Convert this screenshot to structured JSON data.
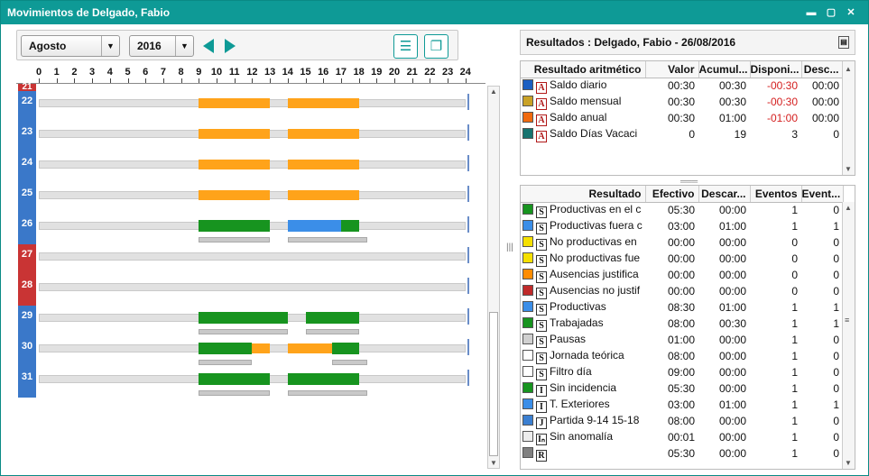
{
  "window": {
    "title": "Movimientos de Delgado, Fabio",
    "controls": [
      "▬",
      "▢",
      "✕"
    ]
  },
  "toolbar": {
    "month": "Agosto",
    "year": "2016"
  },
  "axis": {
    "hours": [
      "0",
      "1",
      "2",
      "3",
      "4",
      "5",
      "6",
      "7",
      "8",
      "9",
      "10",
      "11",
      "12",
      "13",
      "14",
      "15",
      "16",
      "17",
      "18",
      "19",
      "20",
      "21",
      "22",
      "23",
      "24"
    ]
  },
  "days": [
    {
      "label": "21",
      "type": "partial"
    },
    {
      "label": "22",
      "type": "work"
    },
    {
      "label": "23",
      "type": "work"
    },
    {
      "label": "24",
      "type": "work"
    },
    {
      "label": "25",
      "type": "work"
    },
    {
      "label": "26",
      "type": "worked"
    },
    {
      "label": "27",
      "type": "holiday"
    },
    {
      "label": "28",
      "type": "holiday"
    },
    {
      "label": "29",
      "type": "worked"
    },
    {
      "label": "30",
      "type": "worked"
    },
    {
      "label": "31",
      "type": "worked"
    }
  ],
  "results_header": "Resultados : Delgado, Fabio - 26/08/2016",
  "arith": {
    "headers": [
      "Resultado aritmético",
      "Valor",
      "Acumul...",
      "Disponi...",
      "Desc..."
    ],
    "rows": [
      {
        "color": "#1b5fc2",
        "icon": "A",
        "name": "Saldo diario",
        "valor": "00:30",
        "acum": "00:30",
        "disp": "-00:30",
        "desc": "00:00"
      },
      {
        "color": "#c9a227",
        "icon": "A",
        "name": "Saldo mensual",
        "valor": "00:30",
        "acum": "00:30",
        "disp": "-00:30",
        "desc": "00:00"
      },
      {
        "color": "#f06a0f",
        "icon": "A",
        "name": "Saldo anual",
        "valor": "00:30",
        "acum": "01:00",
        "disp": "-01:00",
        "desc": "00:00"
      },
      {
        "color": "#17736f",
        "icon": "A",
        "name": "Saldo Días Vacaci",
        "valor": "0",
        "acum": "19",
        "disp": "3",
        "desc": "0"
      }
    ]
  },
  "results": {
    "headers": [
      "Resultado",
      "Efectivo",
      "Descar...",
      "Eventos",
      "Event..."
    ],
    "rows": [
      {
        "color": "#17941f",
        "icon": "S",
        "name": "Productivas en el c",
        "ef": "05:30",
        "de": "00:00",
        "ev": "1",
        "ev2": "0"
      },
      {
        "color": "#3b8ee8",
        "icon": "S",
        "name": "Productivas fuera c",
        "ef": "03:00",
        "de": "01:00",
        "ev": "1",
        "ev2": "1"
      },
      {
        "color": "#f5e000",
        "icon": "S",
        "name": "No productivas en",
        "ef": "00:00",
        "de": "00:00",
        "ev": "0",
        "ev2": "0"
      },
      {
        "color": "#f5e000",
        "icon": "S",
        "name": "No productivas fue",
        "ef": "00:00",
        "de": "00:00",
        "ev": "0",
        "ev2": "0"
      },
      {
        "color": "#ff8c00",
        "icon": "S",
        "name": "Ausencias justifica",
        "ef": "00:00",
        "de": "00:00",
        "ev": "0",
        "ev2": "0"
      },
      {
        "color": "#c02a2a",
        "icon": "S",
        "name": "Ausencias no justif",
        "ef": "00:00",
        "de": "00:00",
        "ev": "0",
        "ev2": "0"
      },
      {
        "color": "#3b8ee8",
        "icon": "S",
        "name": "Productivas",
        "ef": "08:30",
        "de": "01:00",
        "ev": "1",
        "ev2": "1"
      },
      {
        "color": "#17941f",
        "icon": "S",
        "name": "Trabajadas",
        "ef": "08:00",
        "de": "00:30",
        "ev": "1",
        "ev2": "1"
      },
      {
        "color": "#d0d0d0",
        "icon": "S",
        "name": "Pausas",
        "ef": "01:00",
        "de": "00:00",
        "ev": "1",
        "ev2": "0"
      },
      {
        "color": "#ffffff",
        "icon": "S",
        "name": "Jornada teórica",
        "ef": "08:00",
        "de": "00:00",
        "ev": "1",
        "ev2": "0"
      },
      {
        "color": "#ffffff",
        "icon": "S",
        "name": "Filtro día",
        "ef": "09:00",
        "de": "00:00",
        "ev": "1",
        "ev2": "0"
      },
      {
        "color": "#17941f",
        "icon": "I",
        "name": "Sin incidencia",
        "ef": "05:30",
        "de": "00:00",
        "ev": "1",
        "ev2": "0"
      },
      {
        "color": "#3b8ee8",
        "icon": "I",
        "name": "T. Exteriores",
        "ef": "03:00",
        "de": "01:00",
        "ev": "1",
        "ev2": "1"
      },
      {
        "color": "#3b7fd1",
        "icon": "J",
        "name": "Partida 9-14 15-18",
        "ef": "08:00",
        "de": "00:00",
        "ev": "1",
        "ev2": "0"
      },
      {
        "color": "#ededed",
        "icon": "Iₙ",
        "name": "Sin anomalía",
        "ef": "00:01",
        "de": "00:00",
        "ev": "1",
        "ev2": "0"
      },
      {
        "color": "#808080",
        "icon": "R",
        "name": "",
        "ef": "05:30",
        "de": "00:00",
        "ev": "1",
        "ev2": "0"
      }
    ]
  }
}
